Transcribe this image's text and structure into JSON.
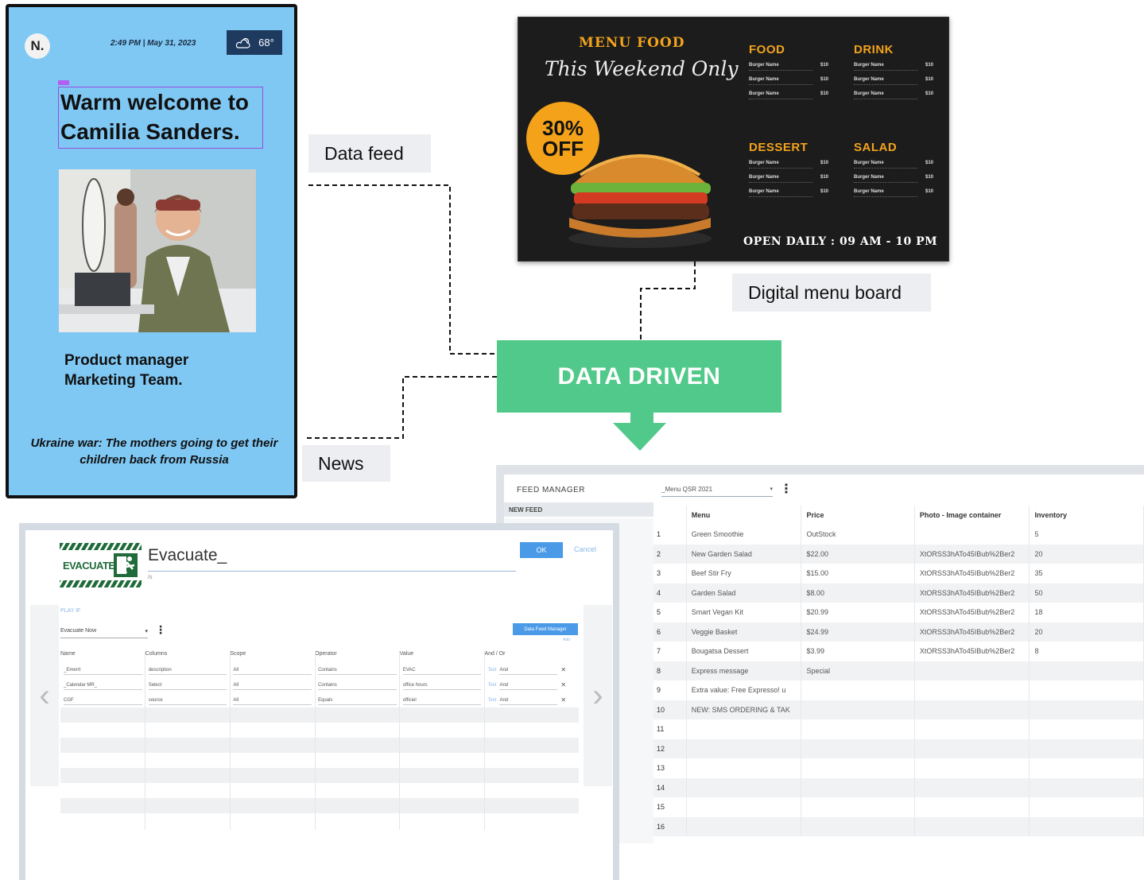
{
  "labels": {
    "data_feed": "Data feed",
    "digital_menu_board": "Digital menu board",
    "news": "News",
    "data_driven": "DATA DRIVEN"
  },
  "kiosk": {
    "logo": "N.",
    "datetime": "2:49 PM | May 31, 2023",
    "temperature": "68°",
    "welcome_line1": "Warm welcome to",
    "welcome_line2": "Camilia Sanders.",
    "role_line1": "Product manager",
    "role_line2": "Marketing Team.",
    "news_line1": "Ukraine war: The mothers going to get their",
    "news_line2": "children back from Russia"
  },
  "menu_board": {
    "title": "MENU FOOD",
    "subtitle": "This Weekend Only",
    "badge_pct": "30%",
    "badge_off": "OFF",
    "sections": [
      {
        "title": "FOOD",
        "items": [
          [
            "Burger Name",
            "$10"
          ],
          [
            "Burger Name",
            "$10"
          ],
          [
            "Burger Name",
            "$10"
          ]
        ]
      },
      {
        "title": "DRINK",
        "items": [
          [
            "Burger Name",
            "$10"
          ],
          [
            "Burger Name",
            "$10"
          ],
          [
            "Burger Name",
            "$10"
          ]
        ]
      },
      {
        "title": "DESSERT",
        "items": [
          [
            "Burger Name",
            "$10"
          ],
          [
            "Burger Name",
            "$10"
          ],
          [
            "Burger Name",
            "$10"
          ]
        ]
      },
      {
        "title": "SALAD",
        "items": [
          [
            "Burger Name",
            "$10"
          ],
          [
            "Burger Name",
            "$10"
          ],
          [
            "Burger Name",
            "$10"
          ]
        ]
      }
    ],
    "hours": "OPEN DAILY : 09 AM - 10 PM"
  },
  "feed_manager": {
    "header": "FEED MANAGER",
    "selected_feed": "_Menu QSR 2021",
    "new_feed": "NEW FEED",
    "columns": [
      "Menu",
      "Price",
      "Photo - Image container",
      "Inventory"
    ],
    "rows": [
      [
        "1",
        "Green Smoothie",
        "OutStock",
        "",
        "5"
      ],
      [
        "2",
        "New Garden Salad",
        "$22.00",
        "XtORSS3hATo45IBub%2Ber2",
        "20"
      ],
      [
        "3",
        "Beef Stir Fry",
        "$15.00",
        "XtORSS3hATo45IBub%2Ber2",
        "35"
      ],
      [
        "4",
        "Garden Salad",
        "$8.00",
        "XtORSS3hATo45IBub%2Ber2",
        "50"
      ],
      [
        "5",
        "Smart Vegan Kit",
        "$20.99",
        "XtORSS3hATo45IBub%2Ber2",
        "18"
      ],
      [
        "6",
        "Veggie Basket",
        "$24.99",
        "XtORSS3hATo45IBub%2Ber2",
        "20"
      ],
      [
        "7",
        "Bougatsa Dessert",
        "$3.99",
        "XtORSS3hATo45IBub%2Ber2",
        "8"
      ],
      [
        "8",
        "Express message",
        "Special",
        "",
        ""
      ],
      [
        "9",
        "Extra value: Free Expresso! u",
        "",
        "",
        ""
      ],
      [
        "10",
        "NEW: SMS ORDERING & TAK",
        "",
        "",
        ""
      ],
      [
        "11",
        "",
        "",
        "",
        ""
      ],
      [
        "12",
        "",
        "",
        "",
        ""
      ],
      [
        "13",
        "",
        "",
        "",
        ""
      ],
      [
        "14",
        "",
        "",
        "",
        ""
      ],
      [
        "15",
        "",
        "",
        "",
        ""
      ],
      [
        "16",
        "",
        "",
        "",
        ""
      ]
    ]
  },
  "evacuate": {
    "logo_text": "EVACUATE",
    "title": "Evacuate_",
    "subtitle": "/s",
    "ok": "OK",
    "cancel": "Cancel",
    "play_if": "PLAY IF",
    "condition": "Evacuate Now",
    "data_feed_manager": "Data Feed Manager",
    "add": "Add",
    "columns": [
      "Name",
      "Columns",
      "Scope",
      "Operator",
      "Value",
      "And / Or"
    ],
    "rows": [
      [
        "_Emerrt",
        "description",
        "All",
        "Contains",
        "EVAC",
        "And"
      ],
      [
        "_Calendar MR_",
        "Select",
        "All",
        "Contains",
        "office hours",
        "And"
      ],
      [
        "CGF",
        "source",
        "All",
        "Equals",
        "officiel",
        "And"
      ]
    ],
    "test_label": "Test",
    "prev": "‹",
    "next": "›"
  }
}
